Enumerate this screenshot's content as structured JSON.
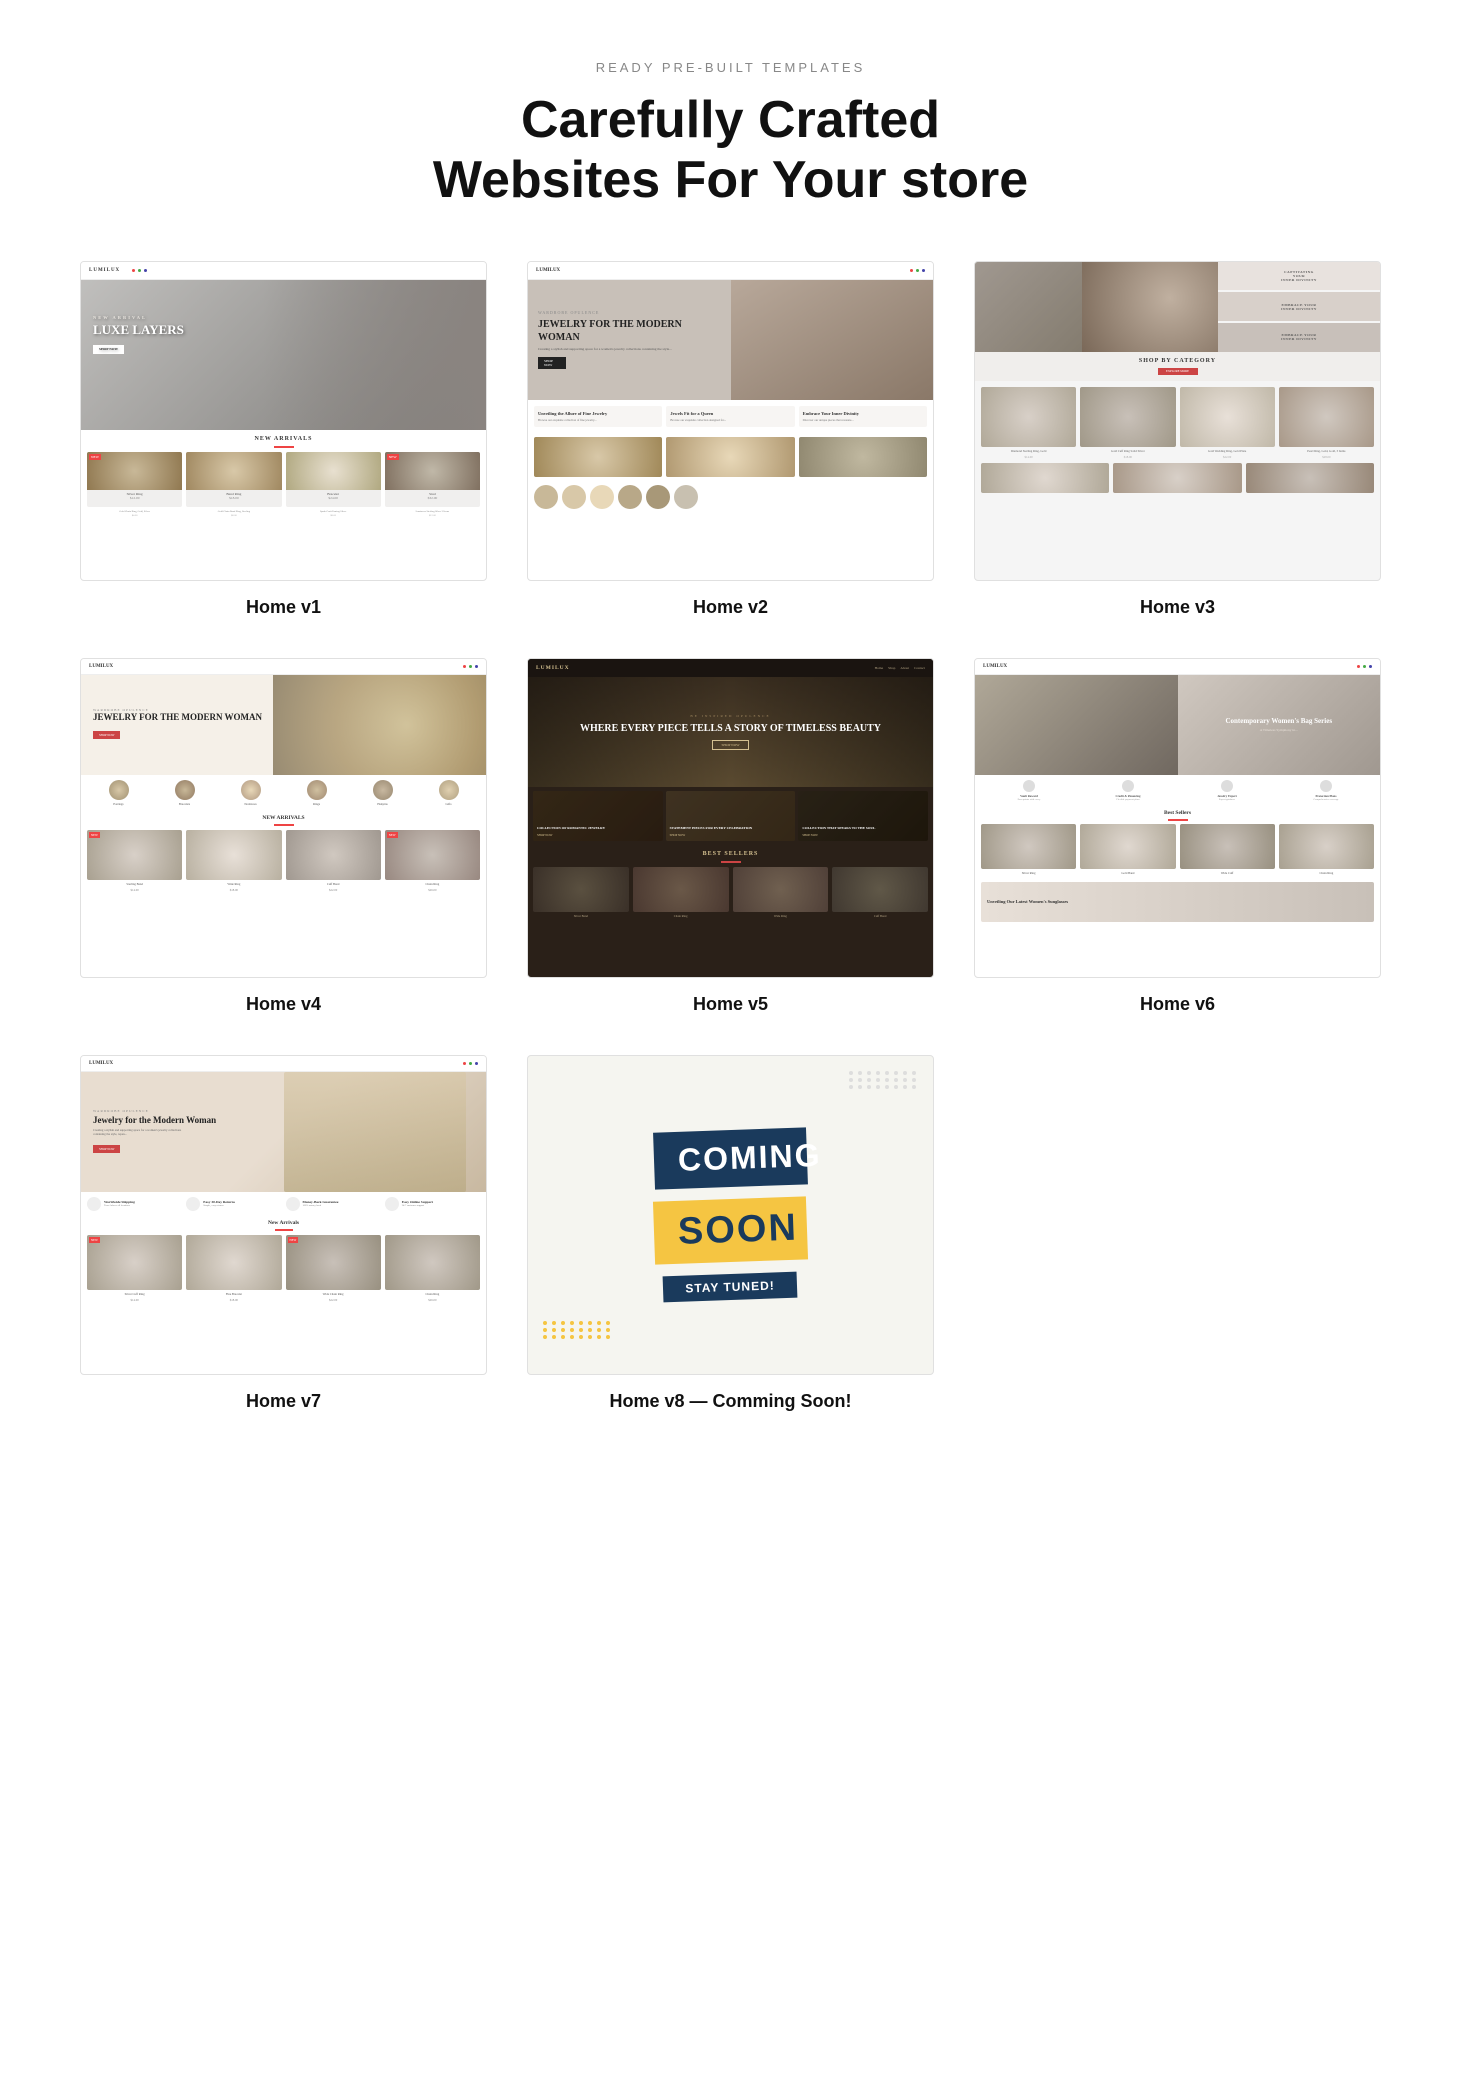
{
  "page": {
    "subtitle": "READY PRE-BUILT TEMPLATES",
    "title_line1": "Carefully Crafted",
    "title_line2": "Websites For Your store"
  },
  "templates": [
    {
      "id": "v1",
      "label": "Home v1",
      "brand": "LUMILUX",
      "hero_title": "LUXE LAYERS",
      "section": "NEW ARRIVALS",
      "products": [
        "Silver Ring",
        "Gold Band",
        "Pearl Bracelet",
        "Diamond Stud"
      ]
    },
    {
      "id": "v2",
      "label": "Home v2",
      "brand": "LUMILUX",
      "hero_eyebrow": "WARDROBE OPULENCE",
      "hero_title": "JEWELRY FOR THE MODERN WOMAN",
      "features": [
        "Unveiling the Allure of Fine Jewelry",
        "Jewels Fit for a Queen",
        "Embrace Your Inner Divinity"
      ]
    },
    {
      "id": "v3",
      "label": "Home v3",
      "section_title": "SHOP BY CATEGORY",
      "products": [
        "Sterling Ring",
        "Silver Band",
        "Gold Ring",
        "Pearl Ring"
      ]
    },
    {
      "id": "v4",
      "label": "Home v4",
      "brand": "LUMILUX",
      "hero_eyebrow": "WARDROBE OPULENCE",
      "hero_title": "JEWELRY FOR THE MODERN WOMAN",
      "hero_btn": "SHOP NOW",
      "categories": [
        "Earrings",
        "Bracelets",
        "Necklaces",
        "Rings",
        "Hairpins",
        "Gifts"
      ],
      "section": "NEW ARRIVALS"
    },
    {
      "id": "v5",
      "label": "Home v5",
      "brand": "LUMILUX",
      "hero_eyebrow": "BE INSPIRED OPULENCE",
      "hero_title": "WHERE EVERY PIECE TELLS A STORY OF TIMELESS BEAUTY",
      "hero_btn": "SHOP NOW",
      "collections": [
        "COLLECTION OF ROMANTIC JEWELRY",
        "STATEMENT PIECES FOR EVERY CELEBRATION",
        "COLLECTION THAT SPEAKS TO THE SOUL"
      ],
      "section": "BEST SELLERS"
    },
    {
      "id": "v6",
      "label": "Home v6",
      "brand": "LUMILUX",
      "hero_tag": "Contemporary Women's Bag Series",
      "features": [
        "Vault Reward",
        "Credit & Financing",
        "Jewelry Expert",
        "Protection Plans"
      ],
      "section": "Best Sellers",
      "promo": "Unveiling Our Latest Women's Sunglasses"
    },
    {
      "id": "v7",
      "label": "Home v7",
      "brand": "LUMILUX",
      "hero_eyebrow": "WARDROBE OPULENCE",
      "hero_title": "Jewelry for the Modern Woman",
      "hero_desc": "Creating a stylish and supporting space for a women's jewelry collections containing the style, repen...",
      "hero_btn": "SHOP NOW",
      "features": [
        "Worldwide Shipping",
        "Easy 30-Day Returns",
        "Money-Back Guarantee",
        "Easy Online Support"
      ],
      "section": "New Arrivals",
      "products": [
        "Silver Cuff Ring",
        "Fine Bracelet",
        "Wide Chain Ring",
        "Chain Ring"
      ]
    },
    {
      "id": "v8",
      "label": "Home v8 — Comming Soon!",
      "coming": "COMING",
      "soon": "SOON",
      "stay_tuned": "STAY TUNED!"
    }
  ]
}
